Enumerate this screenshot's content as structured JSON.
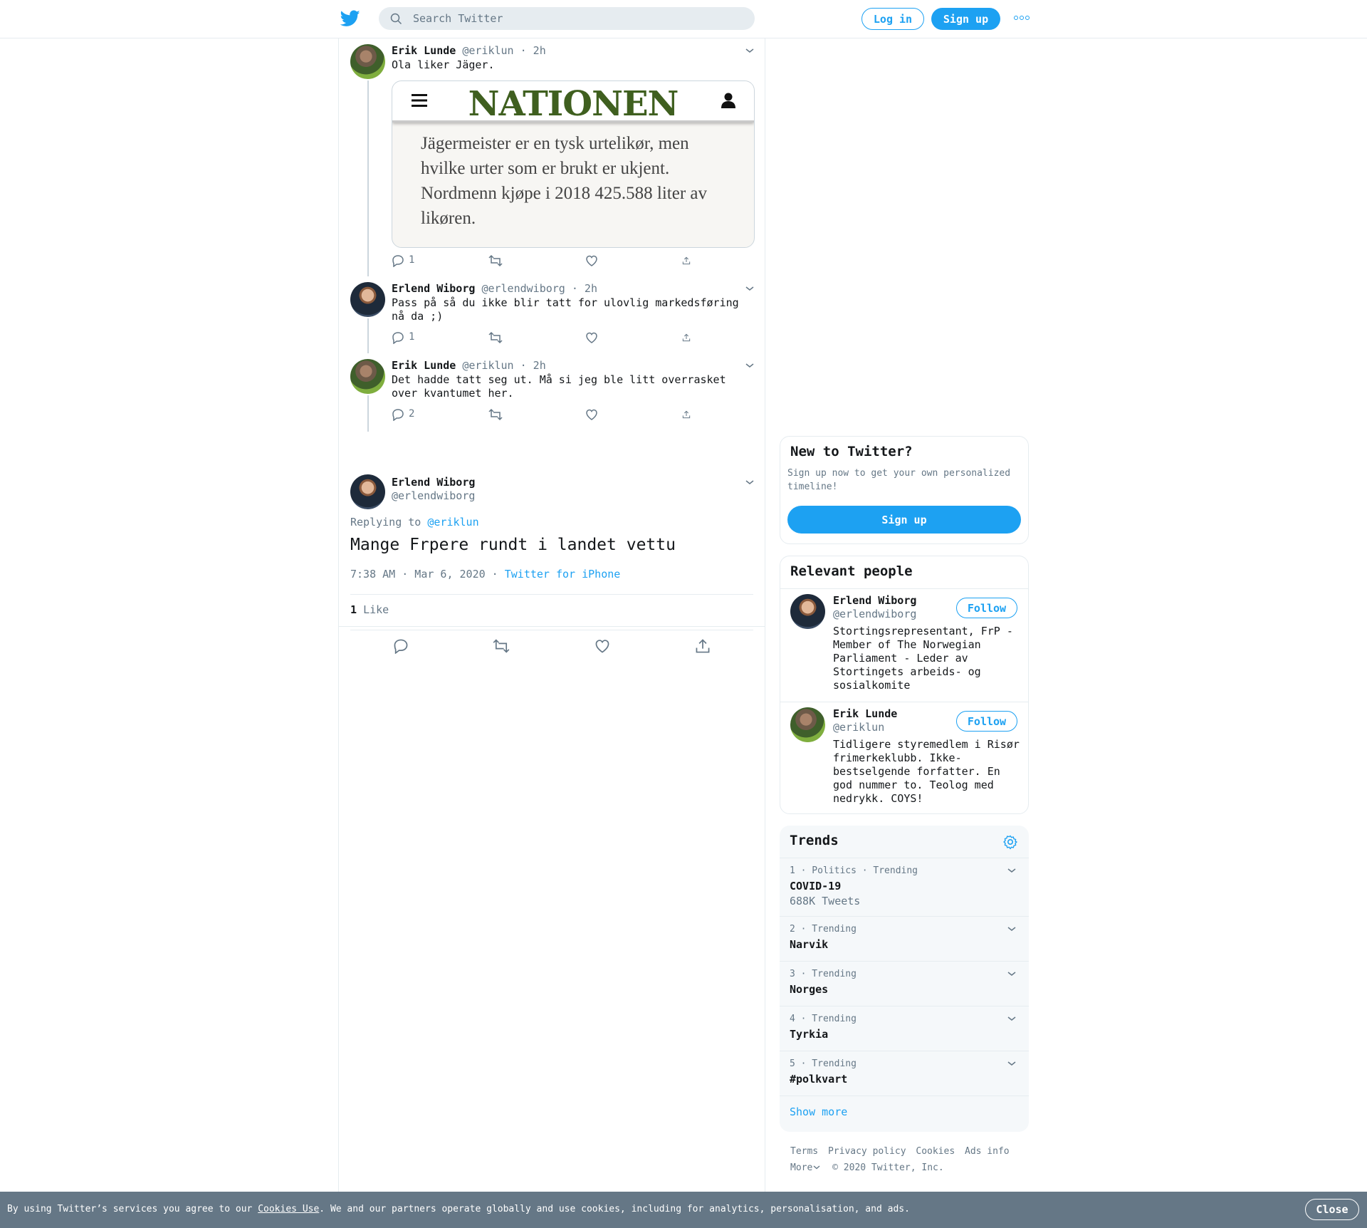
{
  "topbar": {
    "search_placeholder": "Search Twitter",
    "login_label": "Log in",
    "signup_label": "Sign up",
    "logo_icon": "twitter-bird-icon",
    "more_icon": "more-dots-icon"
  },
  "thread": [
    {
      "name": "Erik Lunde",
      "handle": "@eriklun",
      "time": "· 2h",
      "text": "Ola liker Jäger.",
      "replies": "1",
      "card": {
        "logo": "NATIONEN",
        "text": "Jägermeister er en tysk urtelikør, men hvilke urter som er brukt er ukjent. Nordmenn kjøpe i 2018 425.588 liter av likøren."
      }
    },
    {
      "name": "Erlend Wiborg",
      "handle": "@erlendwiborg",
      "time": "· 2h",
      "text": "Pass på så du ikke blir tatt for ulovlig markedsføring nå da ;)",
      "replies": "1"
    },
    {
      "name": "Erik Lunde",
      "handle": "@eriklun",
      "time": "· 2h",
      "text": "Det hadde tatt seg ut. Må si jeg ble litt overrasket over kvantumet her.",
      "replies": "2"
    }
  ],
  "focus": {
    "name": "Erlend Wiborg",
    "handle": "@erlendwiborg",
    "replying_prefix": "Replying to",
    "replying_handle": "@eriklun",
    "text": "Mange Frpere rundt i landet vettu",
    "timestamp": "7:38 AM · Mar 6, 2020 ·",
    "source": "Twitter for iPhone",
    "likes_count": "1",
    "likes_label": "Like"
  },
  "signup_box": {
    "title": "New to Twitter?",
    "subtitle": "Sign up now to get your own personalized timeline!",
    "button": "Sign up"
  },
  "people": {
    "title": "Relevant people",
    "items": [
      {
        "name": "Erlend Wiborg",
        "handle": "@erlendwiborg",
        "follow": "Follow",
        "bio": "Stortingsrepresentant, FrP - Member of The Norwegian Parliament - Leder av Stortingets arbeids- og sosialkomite"
      },
      {
        "name": "Erik Lunde",
        "handle": "@eriklun",
        "follow": "Follow",
        "bio": "Tidligere styremedlem i Risør frimerkeklubb. Ikke-bestselgende forfatter. En god nummer to. Teolog med nedrykk. COYS!"
      }
    ]
  },
  "trends": {
    "title": "Trends",
    "items": [
      {
        "meta": "1 · Politics · Trending",
        "name": "COVID-19",
        "count": "688K Tweets"
      },
      {
        "meta": "2 · Trending",
        "name": "Narvik"
      },
      {
        "meta": "3 · Trending",
        "name": "Norges"
      },
      {
        "meta": "4 · Trending",
        "name": "Tyrkia"
      },
      {
        "meta": "5 · Trending",
        "name": "#polkvart"
      }
    ],
    "show_more": "Show more"
  },
  "footer": {
    "terms": "Terms",
    "privacy": "Privacy policy",
    "cookies": "Cookies",
    "ads": "Ads info",
    "more": "More",
    "copyright": "© 2020 Twitter, Inc."
  },
  "cookie_bar": {
    "prefix": "By using Twitter’s services you agree to our",
    "link": "Cookies Use",
    "suffix": ". We and our partners operate globally and use cookies, including for analytics, personalisation, and ads.",
    "close": "Close"
  },
  "colors": {
    "accent": "#1da1f2",
    "muted": "#657786",
    "cookie_bg": "#657786",
    "nationen_green": "#3f5f1f"
  }
}
